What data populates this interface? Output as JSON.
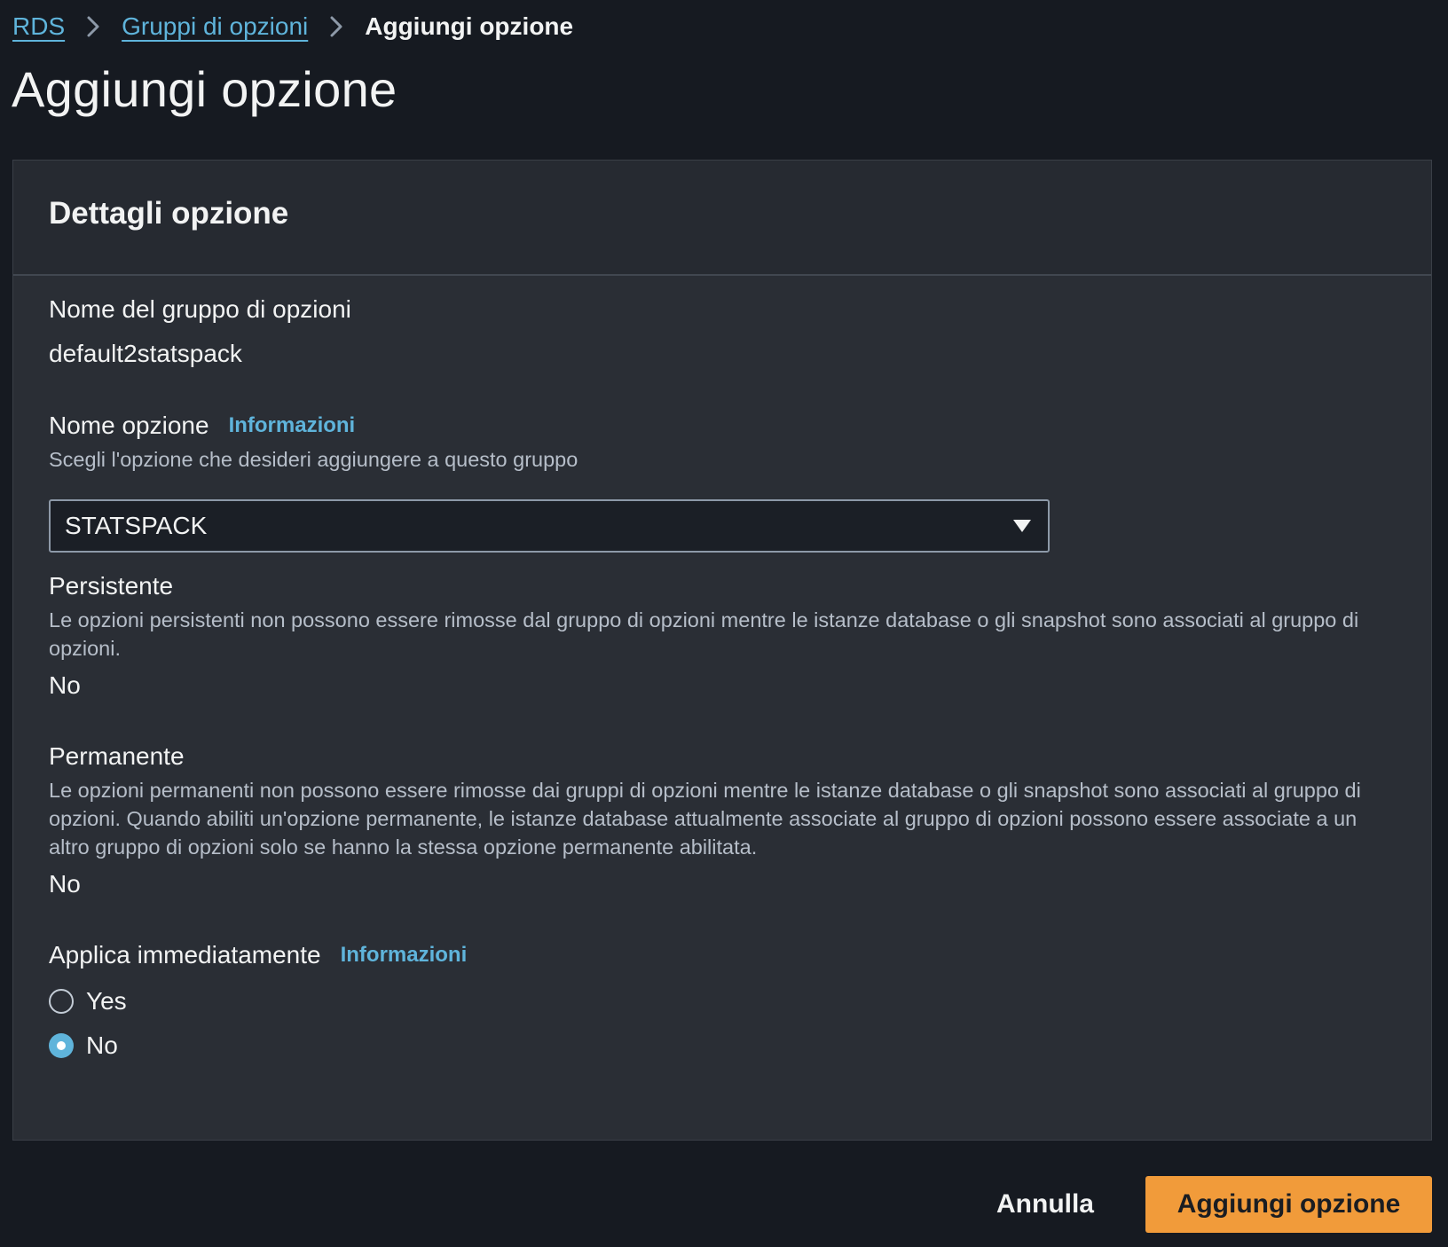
{
  "breadcrumb": {
    "items": [
      {
        "label": "RDS"
      },
      {
        "label": "Gruppi di opzioni"
      },
      {
        "label": "Aggiungi opzione"
      }
    ],
    "separator_icon": "chevron-right-icon"
  },
  "page": {
    "title": "Aggiungi opzione"
  },
  "panel": {
    "title": "Dettagli opzione",
    "option_group": {
      "label": "Nome del gruppo di opzioni",
      "value": "default2statspack"
    },
    "option_name": {
      "label": "Nome opzione",
      "info": "Informazioni",
      "description": "Scegli l'opzione che desideri aggiungere a questo gruppo",
      "selected": "STATSPACK",
      "caret_icon": "caret-down-icon"
    },
    "persistent": {
      "label": "Persistente",
      "description": "Le opzioni persistenti non possono essere rimosse dal gruppo di opzioni mentre le istanze database o gli snapshot sono associati al gruppo di opzioni.",
      "value": "No"
    },
    "permanent": {
      "label": "Permanente",
      "description": "Le opzioni permanenti non possono essere rimosse dai gruppi di opzioni mentre le istanze database o gli snapshot sono associati al gruppo di opzioni. Quando abiliti un'opzione permanente, le istanze database attualmente associate al gruppo di opzioni possono essere associate a un altro gruppo di opzioni solo se hanno la stessa opzione permanente abilitata.",
      "value": "No"
    },
    "apply_immediately": {
      "label": "Applica immediatamente",
      "info": "Informazioni",
      "options": [
        {
          "label": "Yes",
          "checked": false
        },
        {
          "label": "No",
          "checked": true
        }
      ]
    }
  },
  "footer": {
    "cancel_label": "Annulla",
    "submit_label": "Aggiungi opzione"
  },
  "colors": {
    "background": "#161a21",
    "panel": "#2a2e35",
    "link": "#5fb4db",
    "primary_button": "#f19b3a",
    "radio_checked": "#5fb4db"
  }
}
